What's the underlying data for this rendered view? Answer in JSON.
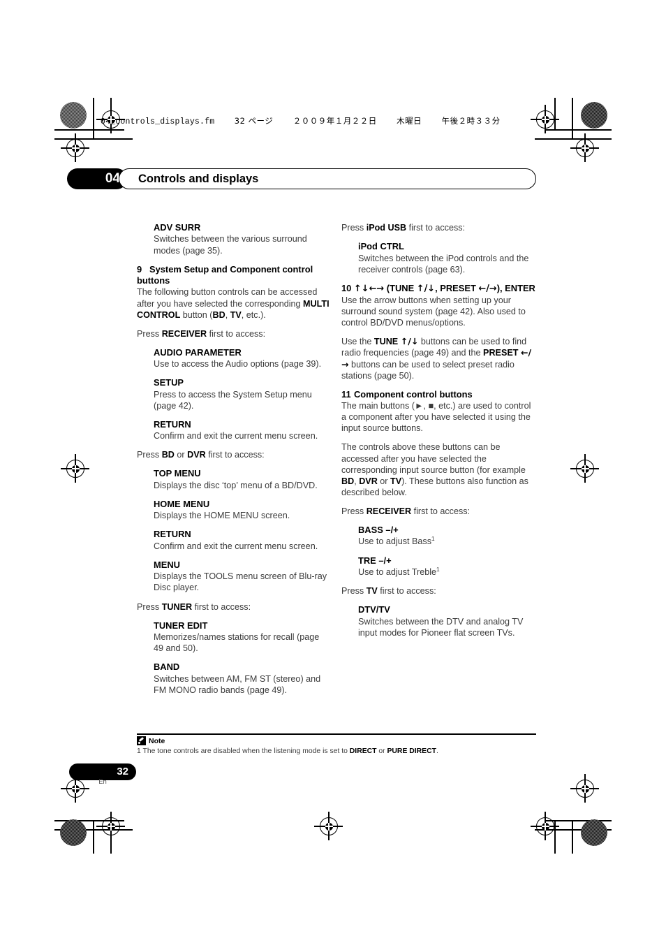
{
  "print_marks": {
    "file_info": "04_controls_displays.fm",
    "page_marker": "32 ページ",
    "date": "２００９年１月２２日",
    "weekday": "木曜日",
    "time": "午後２時３３分"
  },
  "header": {
    "chapter_number": "04",
    "chapter_title": "Controls and displays"
  },
  "left_column": {
    "blocks": [
      {
        "type": "subhead",
        "text": "ADV SURR"
      },
      {
        "type": "body_indent",
        "text": "Switches between the various surround modes (page 35)."
      },
      {
        "type": "numhead",
        "num": "9",
        "text": "System Setup and Component control buttons"
      },
      {
        "type": "body",
        "html": "The following button controls can be accessed after you have selected the corresponding <b>MULTI CONTROL</b> button (<b>BD</b>, <b>TV</b>, etc.)."
      },
      {
        "type": "body",
        "html": "Press <b>RECEIVER</b> first to access:"
      },
      {
        "type": "subhead",
        "text": "AUDIO PARAMETER"
      },
      {
        "type": "body_indent",
        "text": "Use to access the Audio options (page 39)."
      },
      {
        "type": "subhead",
        "text": "SETUP"
      },
      {
        "type": "body_indent",
        "text": "Press to access the System Setup menu (page 42)."
      },
      {
        "type": "subhead",
        "text": "RETURN"
      },
      {
        "type": "body_indent",
        "text": "Confirm and exit the current menu screen."
      },
      {
        "type": "body",
        "html": "Press <b>BD</b> or <b>DVR</b> first to access:"
      },
      {
        "type": "subhead",
        "text": "TOP MENU"
      },
      {
        "type": "body_indent",
        "text": "Displays the disc ‘top’ menu of a BD/DVD."
      },
      {
        "type": "subhead",
        "text": "HOME MENU"
      },
      {
        "type": "body_indent",
        "text": "Displays the HOME MENU screen."
      },
      {
        "type": "subhead",
        "text": "RETURN"
      },
      {
        "type": "body_indent",
        "text": "Confirm and exit the current menu screen."
      },
      {
        "type": "subhead",
        "text": "MENU"
      },
      {
        "type": "body_indent",
        "text": "Displays the TOOLS menu screen of Blu-ray Disc player."
      },
      {
        "type": "body",
        "html": "Press <b>TUNER</b> first to access:"
      },
      {
        "type": "subhead",
        "text": "TUNER EDIT"
      },
      {
        "type": "body_indent",
        "text": "Memorizes/names stations for recall (page 49 and 50)."
      },
      {
        "type": "subhead",
        "text": "BAND"
      },
      {
        "type": "body_indent",
        "text": "Switches between AM, FM ST (stereo) and FM MONO radio bands (page 49)."
      }
    ]
  },
  "right_column": {
    "blocks": [
      {
        "type": "body",
        "html": "Press <b>iPod USB</b> first to access:"
      },
      {
        "type": "subhead",
        "text": "iPod CTRL"
      },
      {
        "type": "body_indent",
        "text": "Switches between the iPod controls and the receiver controls (page 63)."
      },
      {
        "type": "numhead",
        "num": "10",
        "html": "<span class=\"arrow\">↑↓←→</span> (TUNE <span class=\"arrow\">↑/↓</span>, PRESET <span class=\"arrow\">←/→</span>), ENTER"
      },
      {
        "type": "body",
        "html": "Use the arrow buttons when setting up your surround sound system (page 42). Also used to control BD/DVD menus/options."
      },
      {
        "type": "body",
        "html": "Use the <b>TUNE</b> <b class=\"arrow\">↑/↓</b> buttons can be used to find radio frequencies (page 49) and the <b>PRESET</b> <b class=\"arrow\">←/→</b> buttons can be used to select preset radio stations (page 50)."
      },
      {
        "type": "numhead",
        "num": "11",
        "text": "Component control buttons"
      },
      {
        "type": "body",
        "html": "The main buttons (►, ■, etc.) are used to control a component after you have selected it using the input source buttons."
      },
      {
        "type": "body",
        "html": "The controls above these buttons can be accessed after you have selected the corresponding input source button (for example <b>BD</b>, <b>DVR</b> or <b>TV</b>). These buttons also function as described below."
      },
      {
        "type": "body",
        "html": "Press <b>RECEIVER</b> first to access:"
      },
      {
        "type": "subhead",
        "text": "BASS –/+"
      },
      {
        "type": "body_indent",
        "html": "Use to adjust Bass<sup>1</sup>"
      },
      {
        "type": "subhead",
        "text": "TRE –/+"
      },
      {
        "type": "body_indent",
        "html": "Use to adjust Treble<sup>1</sup>"
      },
      {
        "type": "body",
        "html": "Press <b>TV</b> first to access:"
      },
      {
        "type": "subhead",
        "text": "DTV/TV"
      },
      {
        "type": "body_indent",
        "text": "Switches between the DTV and analog TV input modes for Pioneer flat screen TVs."
      }
    ]
  },
  "footnote": {
    "label": "Note",
    "text_html": "1 The tone controls are disabled when the listening mode is set to <b>DIRECT</b> or <b>PURE DIRECT</b>."
  },
  "page_footer": {
    "number": "32",
    "language": "En"
  }
}
